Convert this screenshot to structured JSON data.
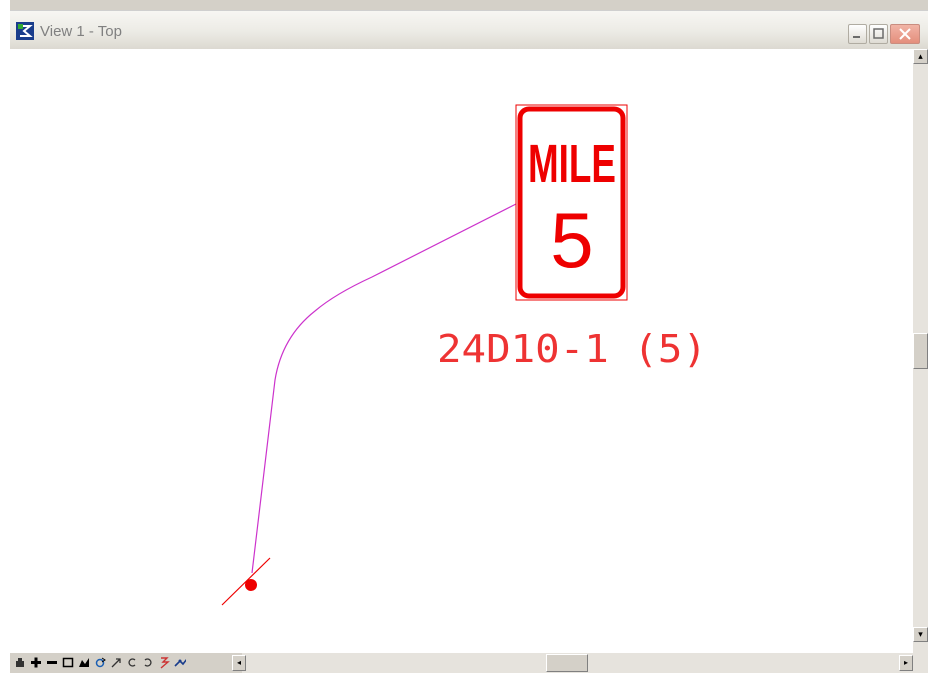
{
  "window": {
    "title": "View 1 - Top"
  },
  "drawing": {
    "sign_line1": "MILE",
    "sign_line2": "5",
    "sign_code": "24D10-1 (5)",
    "sign_color": "#ee0000",
    "leader_color": "#cc33cc"
  },
  "toolbar": {
    "icons": [
      "update-view-icon",
      "zoom-in-icon",
      "zoom-out-icon",
      "window-area-icon",
      "fit-view-icon",
      "rotate-view-icon",
      "pan-view-icon",
      "view-previous-icon",
      "view-next-icon",
      "copy-view-icon",
      "view-settings-icon"
    ]
  },
  "scroll": {
    "left_arrow": "◂",
    "right_arrow": "▸",
    "up_arrow": "▴",
    "down_arrow": "▾"
  }
}
